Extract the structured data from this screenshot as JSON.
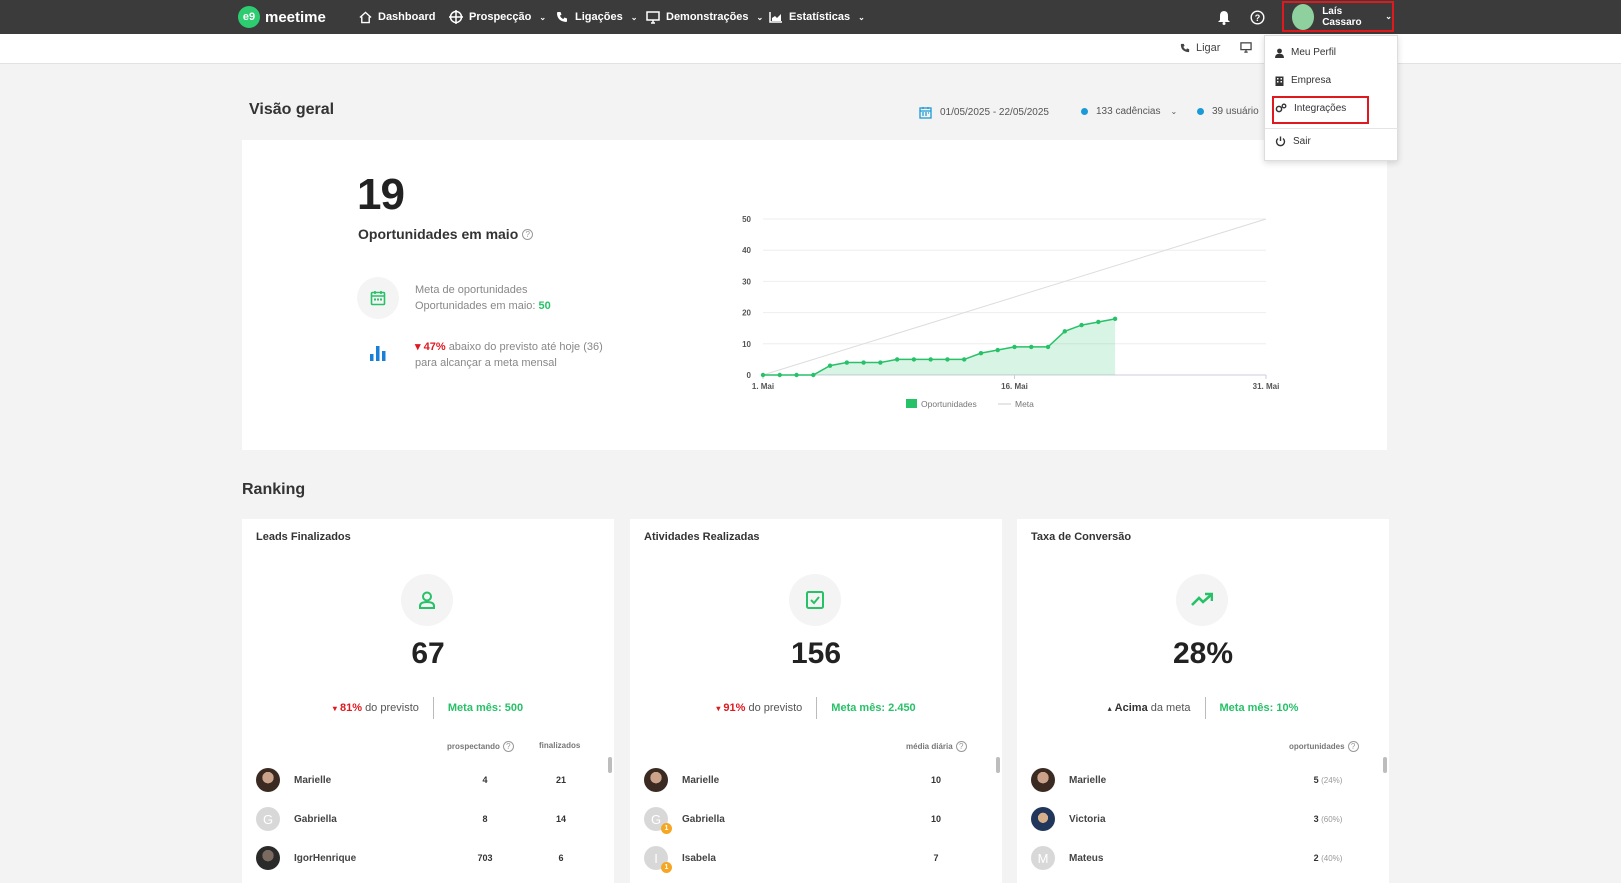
{
  "brand": {
    "badge": "e9",
    "name": "meetime"
  },
  "nav": {
    "dashboard": "Dashboard",
    "prospeccao": "Prospecção",
    "ligacoes": "Ligações",
    "demonstracoes": "Demonstrações",
    "estatisticas": "Estatísticas"
  },
  "user": {
    "name": "Laís Cassaro"
  },
  "subbar": {
    "ligar": "Ligar"
  },
  "header": {
    "title": "Visão geral",
    "date_range": "01/05/2025 - 22/05/2025",
    "cadences": "133 cadências",
    "users": "39 usuário"
  },
  "overview": {
    "count": "19",
    "subtitle": "Oportunidades em maio",
    "meta_line1": "Meta de oportunidades",
    "meta_line2_prefix": "Oportunidades em maio:",
    "meta_value": "50",
    "below_pct": "47%",
    "below_line1": "abaixo do previsto até hoje (36)",
    "below_line2": "para alcançar a meta mensal"
  },
  "chart_data": {
    "type": "line",
    "title": "",
    "xlabel": "",
    "ylabel": "",
    "ylim": [
      0,
      50
    ],
    "yticks": [
      "50",
      "40",
      "30",
      "20",
      "10",
      "0"
    ],
    "xticks": [
      "1. Mai",
      "16. Mai",
      "31. Mai"
    ],
    "legend": {
      "oportunidades": "Oportunidades",
      "meta": "Meta"
    },
    "legend_placement": "bottom",
    "series": [
      {
        "name": "Oportunidades",
        "type": "area",
        "color": "#27c168",
        "x": [
          1,
          2,
          3,
          4,
          5,
          6,
          7,
          8,
          9,
          10,
          11,
          12,
          13,
          14,
          15,
          16,
          17,
          18,
          19,
          20,
          21,
          22
        ],
        "values": [
          0,
          0,
          0,
          0,
          3,
          4,
          4,
          4,
          5,
          5,
          5,
          5,
          5,
          7,
          8,
          9,
          9,
          9,
          14,
          16,
          17,
          18
        ]
      },
      {
        "name": "Meta",
        "type": "line",
        "color": "#dcdcdc",
        "x": [
          1,
          31
        ],
        "values": [
          0,
          50
        ]
      }
    ]
  },
  "ranking": {
    "title": "Ranking",
    "cards": [
      {
        "title": "Leads Finalizados",
        "value": "67",
        "stat_pct": "81%",
        "stat_text": "do previsto",
        "meta": "Meta mês: 500",
        "headers": [
          "prospectando",
          "finalizados"
        ],
        "rows": [
          {
            "initial": "",
            "name": "Marielle",
            "a": "4",
            "b": "21"
          },
          {
            "initial": "G",
            "name": "Gabriella",
            "a": "8",
            "b": "14"
          },
          {
            "initial": "",
            "name": "IgorHenrique",
            "a": "703",
            "b": "6"
          }
        ]
      },
      {
        "title": "Atividades Realizadas",
        "value": "156",
        "stat_pct": "91%",
        "stat_text": "do previsto",
        "meta": "Meta mês: 2.450",
        "headers": [
          "média diária"
        ],
        "rows": [
          {
            "initial": "",
            "name": "Marielle",
            "a": "10"
          },
          {
            "initial": "G",
            "name": "Gabriella",
            "a": "10",
            "badge": "1"
          },
          {
            "initial": "I",
            "name": "Isabela",
            "a": "7",
            "badge": "1"
          }
        ]
      },
      {
        "title": "Taxa de Conversão",
        "value": "28%",
        "stat_pct": "Acima",
        "stat_text": "da meta",
        "meta": "Meta mês: 10%",
        "headers": [
          "oportunidades"
        ],
        "rows": [
          {
            "initial": "",
            "name": "Marielle",
            "a": "5",
            "pct": "(24%)"
          },
          {
            "initial": "",
            "name": "Victoria",
            "a": "3",
            "pct": "(60%)"
          },
          {
            "initial": "M",
            "name": "Mateus",
            "a": "2",
            "pct": "(40%)"
          }
        ]
      }
    ]
  },
  "dropdown": {
    "meu_perfil": "Meu Perfil",
    "empresa": "Empresa",
    "integracoes": "Integrações",
    "sair": "Sair"
  },
  "colors": {
    "accent": "#27c168",
    "alert": "#e0191f",
    "nav": "#3b3b3b",
    "info": "#1a9ad6"
  }
}
